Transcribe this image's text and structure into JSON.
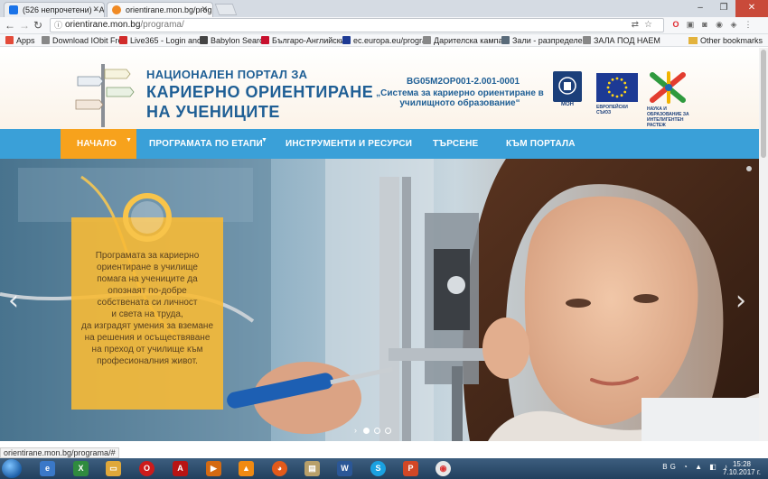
{
  "browser": {
    "tabs": [
      {
        "title": "(526 непрочетени) - Ab"
      },
      {
        "title": "orientirane.mon.bg/prog"
      }
    ],
    "url_host": "orientirane.mon.bg",
    "url_path": "/programa/",
    "bookmarks": [
      {
        "label": "Apps",
        "icon": "apps-grid-icon",
        "color": "#e34b3a"
      },
      {
        "label": "Download IObit Free",
        "icon": "page-icon",
        "color": "#888888"
      },
      {
        "label": "Live365 - Login and",
        "icon": "live365-icon",
        "color": "#d12b2b"
      },
      {
        "label": "Babylon Search",
        "icon": "babylon-icon",
        "color": "#444444"
      },
      {
        "label": "Българо-Английски",
        "icon": "kik-icon",
        "color": "#c8102e"
      },
      {
        "label": "ec.europa.eu/progra",
        "icon": "eu-icon",
        "color": "#1d3a94"
      },
      {
        "label": "Дарителска кампан",
        "icon": "page-icon",
        "color": "#888888"
      },
      {
        "label": "Зали - разпределен",
        "icon": "gear-icon",
        "color": "#5a6b7a"
      },
      {
        "label": "ЗАЛА ПОД НАЕМ",
        "icon": "page-icon",
        "color": "#888888"
      }
    ],
    "other_bookmarks": "Other bookmarks",
    "status_url": "orientirane.mon.bg/programa/#"
  },
  "header": {
    "portal_pre": "НАЦИОНАЛЕН ПОРТАЛ ЗА",
    "portal_line1": "КАРИЕРНО ОРИЕНТИРАНЕ",
    "portal_line2": "НА УЧЕНИЦИТЕ",
    "project_code": "BG05M2OP001-2.001-0001",
    "project_name": "„Система за кариерно ориентиране в училищното образование“",
    "logo_mon_label": "МОН",
    "logo_eu_label": "ЕВРОПЕЙСКИ СЪЮЗ",
    "logo_nauka_label": "НАУКА И ОБРАЗОВАНИЕ ЗА ИНТЕЛИГЕНТЕН РАСТЕЖ"
  },
  "nav": {
    "items": [
      {
        "label": "НАЧАЛО",
        "active": true,
        "dropdown": true
      },
      {
        "label": "ПРОГРАМАТА ПО ЕТАПИ",
        "active": false,
        "dropdown": true
      },
      {
        "label": "ИНСТРУМЕНТИ И РЕСУРСИ",
        "active": false,
        "dropdown": false
      },
      {
        "label": "ТЪРСЕНЕ",
        "active": false,
        "dropdown": false
      },
      {
        "label": "КЪМ ПОРТАЛА",
        "active": false,
        "dropdown": false
      }
    ]
  },
  "hero": {
    "caption_lines": [
      "Програмата за кариерно",
      "ориентиране в училище",
      "помага на учениците да",
      "опознаят по-добре",
      "собствената си личност",
      "и света на труда,",
      "да изградят умения за вземане",
      "на решения и осъществяване",
      "на преход от училище към",
      "професионалния живот."
    ],
    "slide_count": 3,
    "active_slide": 1
  },
  "taskbar": {
    "lang": "BG",
    "time": "15:28",
    "date": "7.10.2017 г."
  },
  "colors": {
    "nav_bg": "#3aa0d8",
    "nav_active": "#f7a21c",
    "title_blue": "#1f5f95",
    "caption_bg": "#f7ba36"
  }
}
